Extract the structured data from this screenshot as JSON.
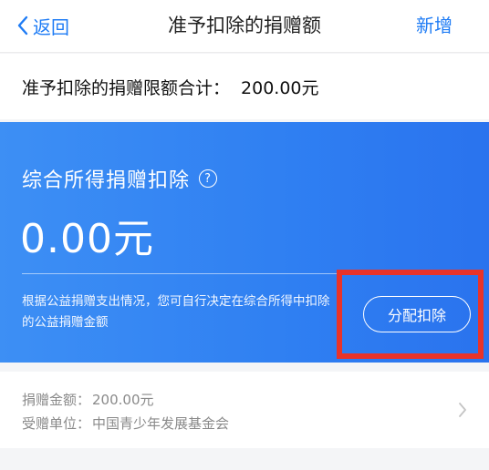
{
  "nav": {
    "back_label": "返回",
    "title": "准予扣除的捐赠额",
    "add_label": "新增"
  },
  "total": {
    "label": "准予扣除的捐赠限额合计：",
    "amount": "200.00元"
  },
  "card": {
    "title": "综合所得捐赠扣除",
    "help_glyph": "?",
    "amount": "0.00元",
    "description": "根据公益捐赠支出情况，您可自行决定在综合所得中扣除的公益捐赠金额",
    "allocate_label": "分配扣除"
  },
  "donation": {
    "amount_label": "捐赠金额：",
    "amount_value": "200.00元",
    "org_label": "受赠单位：",
    "org_value": "中国青少年发展基金会"
  },
  "colors": {
    "accent": "#1f7cf5",
    "card_blue": "#2f7ff2",
    "highlight_red": "#e8332a"
  }
}
